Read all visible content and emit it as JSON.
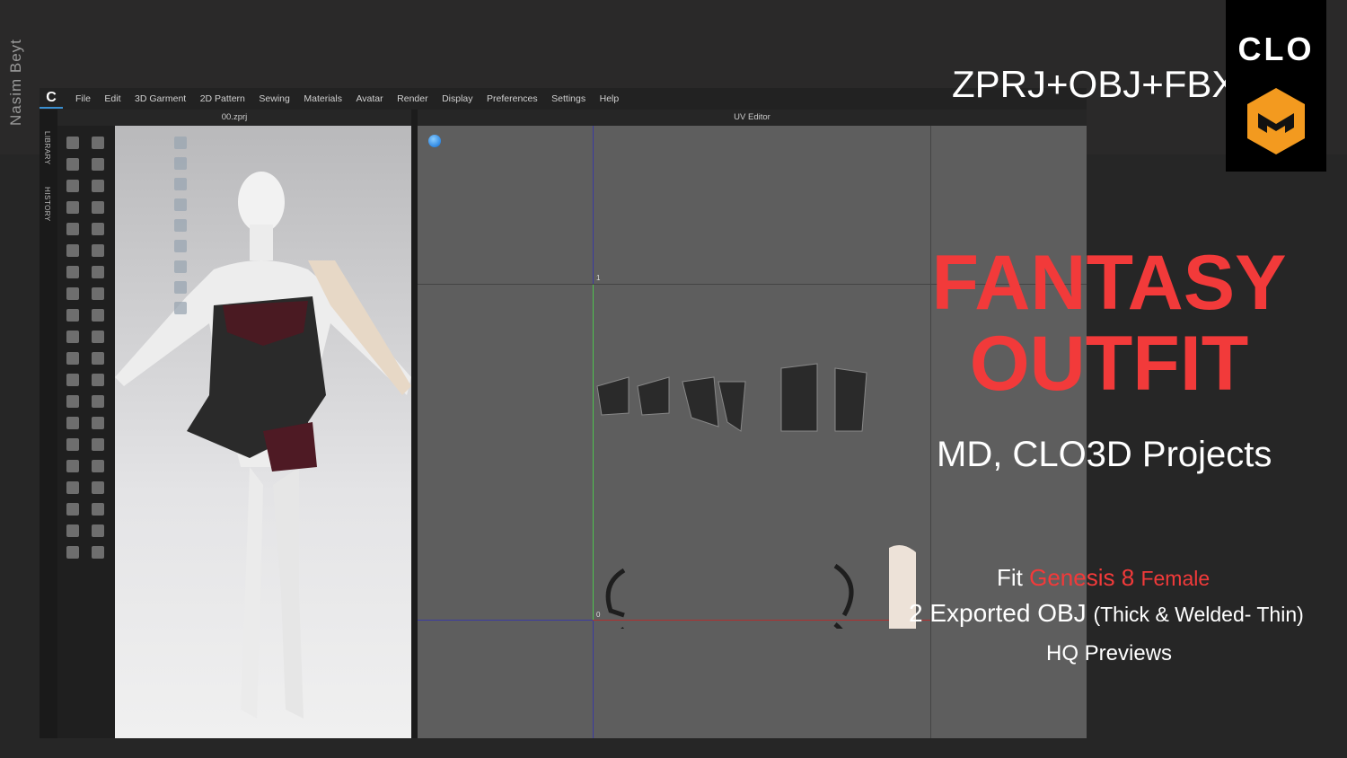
{
  "author": "Nasim Beyt",
  "menu": [
    "File",
    "Edit",
    "3D Garment",
    "2D Pattern",
    "Sewing",
    "Materials",
    "Avatar",
    "Render",
    "Display",
    "Preferences",
    "Settings",
    "Help"
  ],
  "side_tabs": {
    "library": "LIBRARY",
    "history": "HISTORY"
  },
  "panes": {
    "left_title": "00.zprj",
    "right_title": "UV Editor"
  },
  "uv_axis": {
    "one": "1",
    "zero": "0"
  },
  "promo": {
    "formats": "ZPRJ+OBJ+FBX",
    "brand": "CLO",
    "title_line1": "FANTASY",
    "title_line2": "OUTFIT",
    "subtitle": "MD, CLO3D Projects",
    "fit_prefix": "Fit",
    "fit_model": "Genesis 8",
    "fit_suffix": "Female",
    "export_main": "2 Exported OBJ",
    "export_detail": "(Thick & Welded- Thin)",
    "previews": "HQ Previews"
  },
  "colors": {
    "accent_red": "#f23a3a",
    "logo_orange": "#f39a1f"
  }
}
